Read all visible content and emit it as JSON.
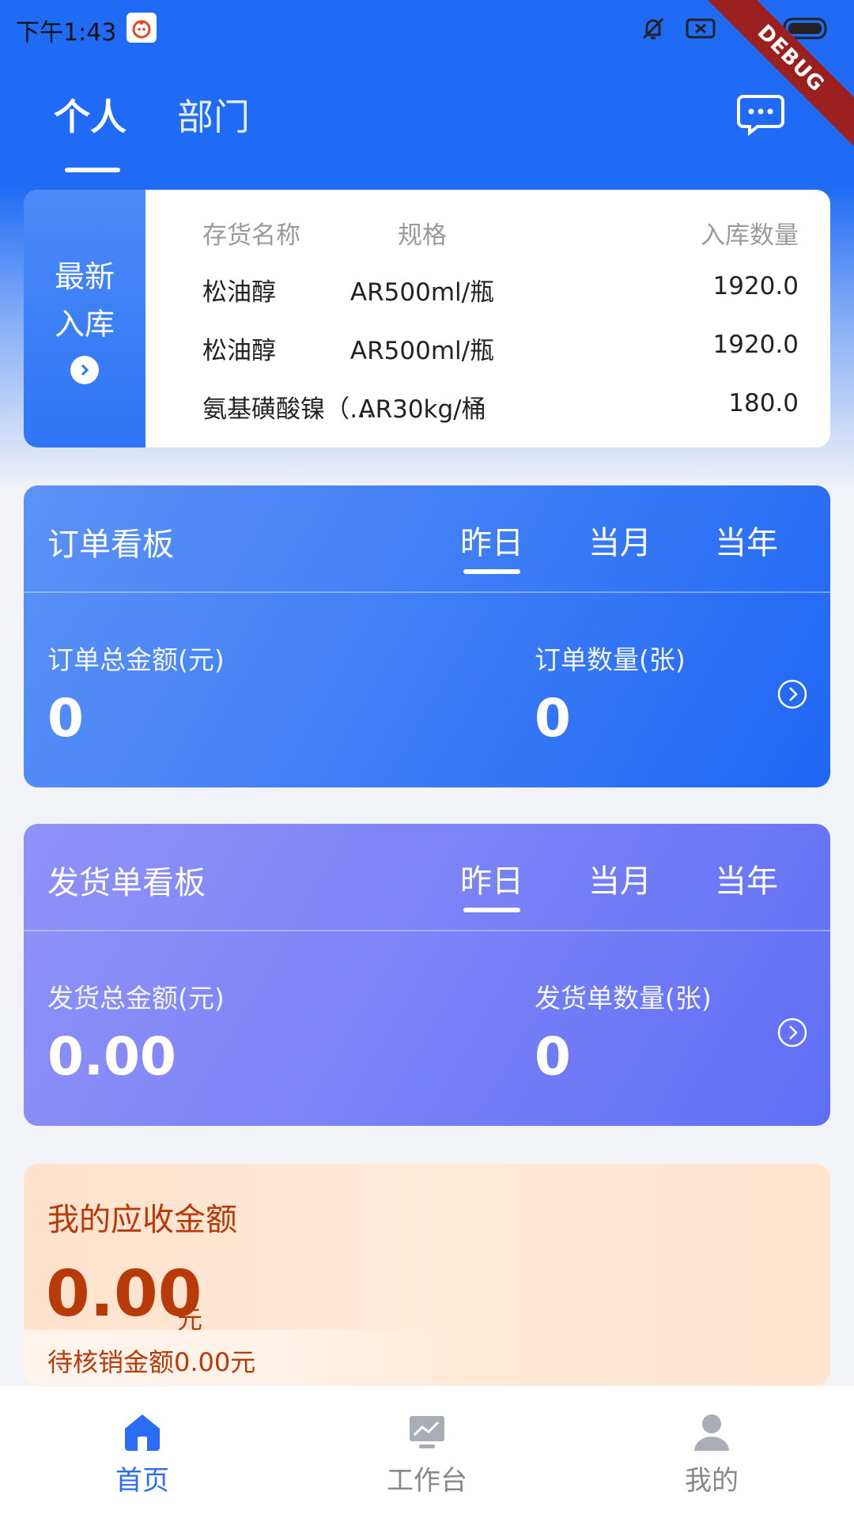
{
  "status_bar": {
    "time": "下午1:43",
    "debug_label": "DEBUG"
  },
  "top_tabs": [
    {
      "label": "个人",
      "selected": true
    },
    {
      "label": "部门",
      "selected": false
    }
  ],
  "message_button": {
    "icon": "chat-bubble-icon"
  },
  "inventory": {
    "side_title_line1": "最新",
    "side_title_line2": "入库",
    "headers": {
      "name": "存货名称",
      "spec": "规格",
      "qty": "入库数量"
    },
    "rows": [
      {
        "name": "松油醇",
        "spec": "AR500ml/瓶",
        "qty": "1920.0"
      },
      {
        "name": "松油醇",
        "spec": "AR500ml/瓶",
        "qty": "1920.0"
      },
      {
        "name": "氨基磺酸镍（…",
        "spec": "AR30kg/桶",
        "qty": "180.0"
      }
    ]
  },
  "order_board": {
    "title": "订单看板",
    "periods": [
      "昨日",
      "当月",
      "当年"
    ],
    "selected_period": "昨日",
    "amount_label": "订单总金额(元)",
    "amount_value": "0",
    "count_label": "订单数量(张)",
    "count_value": "0"
  },
  "shipment_board": {
    "title": "发货单看板",
    "periods": [
      "昨日",
      "当月",
      "当年"
    ],
    "selected_period": "昨日",
    "amount_label": "发货总金额(元)",
    "amount_value": "0.00",
    "count_label": "发货单数量(张)",
    "count_value": "0"
  },
  "receivable": {
    "title": "我的应收金额",
    "amount": "0.00",
    "unit": "元",
    "pending": "待核销金额0.00元"
  },
  "bottom_nav": [
    {
      "label": "首页",
      "icon": "home-icon",
      "active": true
    },
    {
      "label": "工作台",
      "icon": "workbench-icon",
      "active": false
    },
    {
      "label": "我的",
      "icon": "profile-icon",
      "active": false
    }
  ],
  "colors": {
    "primary": "#1f6bf5",
    "order_board": "#3e7ef6",
    "shipment_board": "#7b82f7",
    "receivable_text": "#b83a08",
    "nav_active": "#2b6cf5"
  }
}
